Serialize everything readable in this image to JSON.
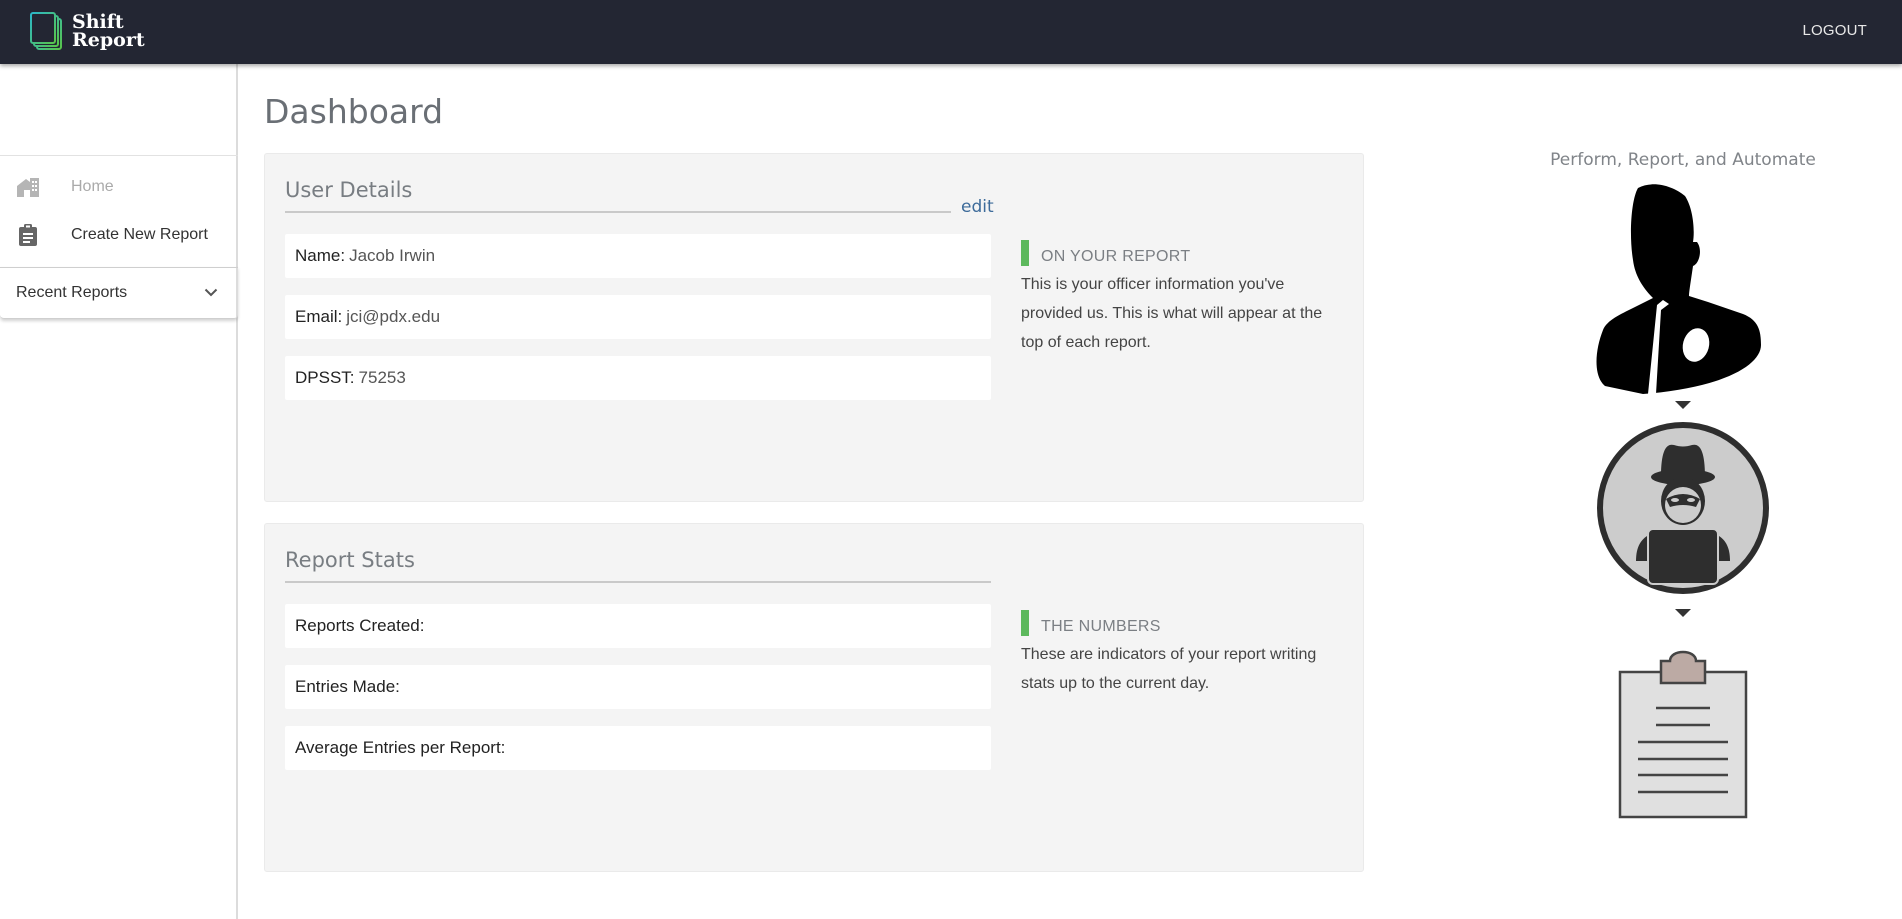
{
  "header": {
    "app_name_line1": "Shift",
    "app_name_line2": "Report",
    "logout_label": "LOGOUT",
    "logo_icon": "stacked-pages-icon",
    "colors": {
      "bar": "#232633",
      "logo_gradient_start": "#2bb7c9",
      "logo_gradient_end": "#58c44a"
    }
  },
  "sidebar": {
    "items": [
      {
        "label": "Home",
        "icon": "home-icon",
        "state": "disabled"
      },
      {
        "label": "Create New Report",
        "icon": "clipboard-icon",
        "state": "normal"
      }
    ],
    "recent_reports": {
      "label": "Recent Reports",
      "icon": "chevron-down-icon",
      "expanded": false
    }
  },
  "main": {
    "title": "Dashboard",
    "user_details": {
      "title": "User Details",
      "edit_label": "edit",
      "fields": [
        {
          "label": "Name:",
          "value": "Jacob Irwin"
        },
        {
          "label": "Email:",
          "value": "jci@pdx.edu"
        },
        {
          "label": "DPSST:",
          "value": "75253"
        }
      ],
      "info": {
        "heading": "ON YOUR REPORT",
        "text": "This is your officer information you've provided us. This is what will appear at the top of each report."
      }
    },
    "report_stats": {
      "title": "Report Stats",
      "fields": [
        {
          "label": "Reports Created:",
          "value": ""
        },
        {
          "label": "Entries Made:",
          "value": ""
        },
        {
          "label": "Average Entries per Report:",
          "value": ""
        }
      ],
      "info": {
        "heading": "THE NUMBERS",
        "text": "These are indicators of your report writing stats up to the current day."
      }
    },
    "accent_color": "#5cb85c"
  },
  "aside": {
    "tagline": "Perform, Report, and Automate",
    "illustrations": [
      "officer-silhouette-icon",
      "arrow-down-icon",
      "hacker-laptop-icon",
      "arrow-down-icon",
      "clipboard-report-icon"
    ]
  }
}
